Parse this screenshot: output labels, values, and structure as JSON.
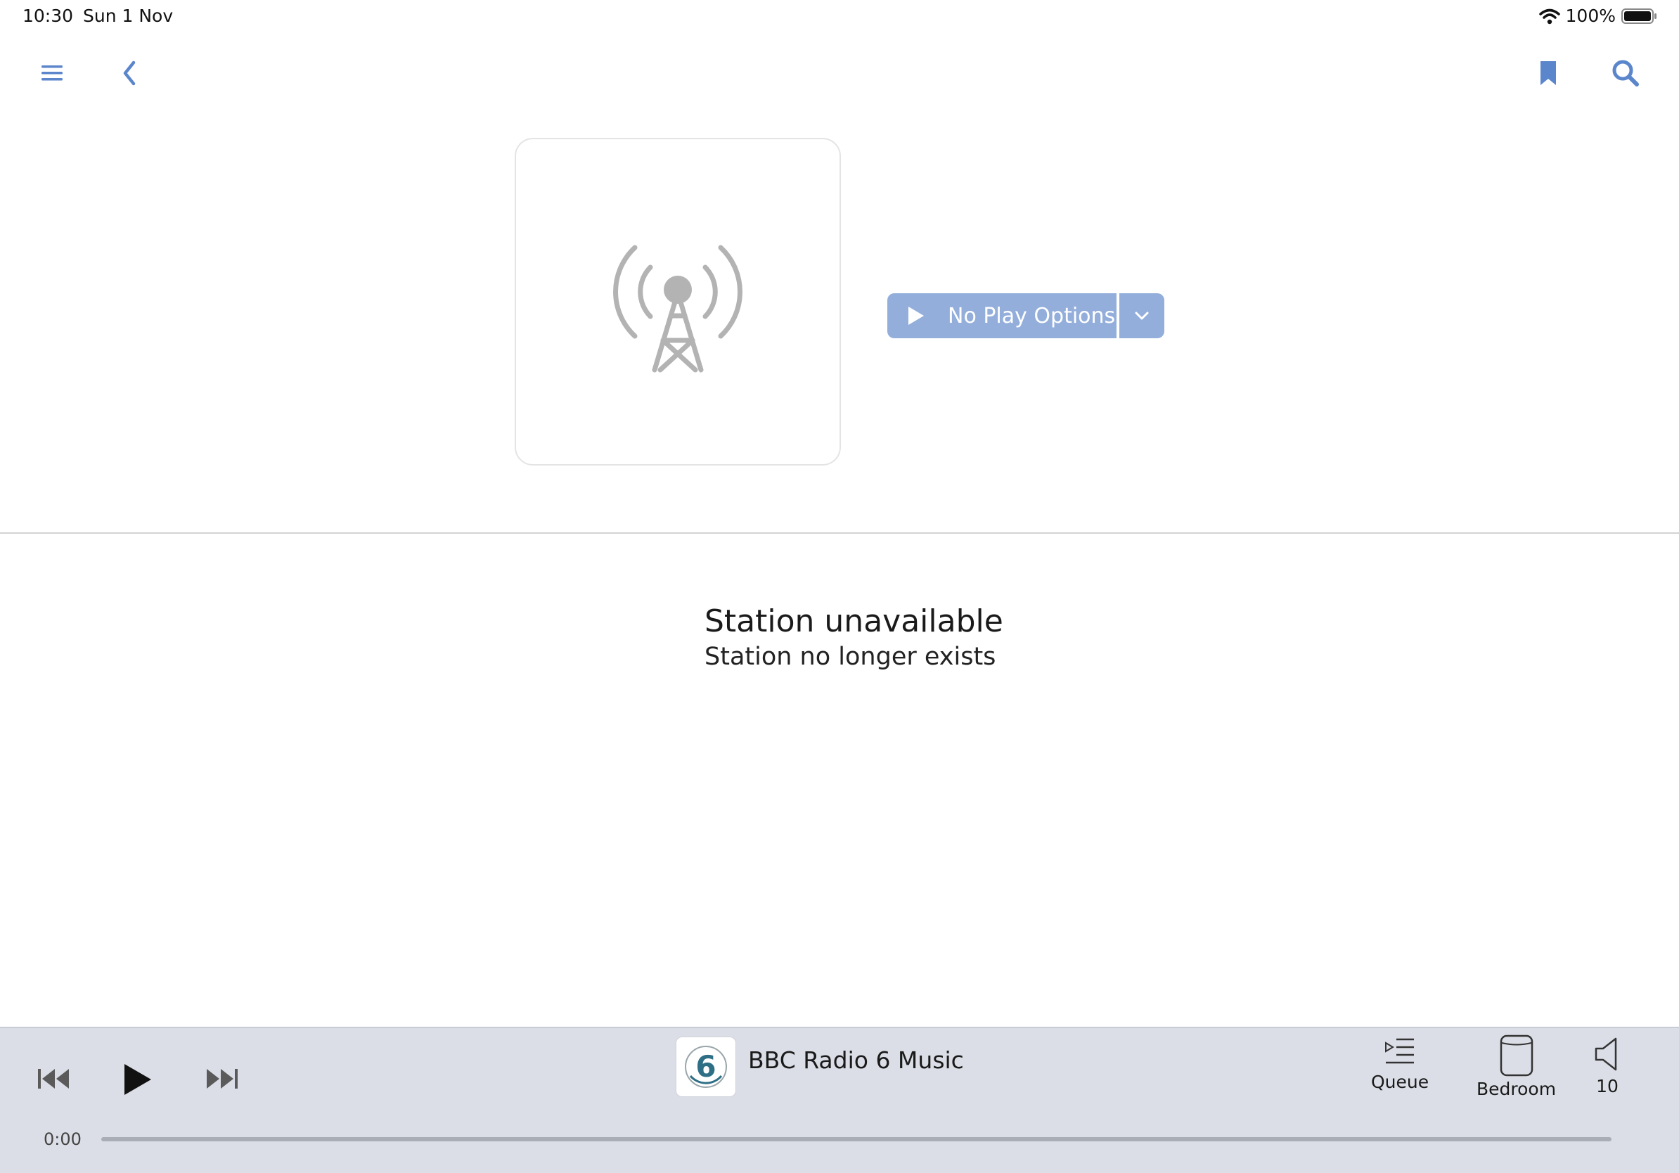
{
  "status_bar": {
    "time": "10:30",
    "date": "Sun 1 Nov",
    "battery": "100%"
  },
  "nav": {
    "menu_icon": "hamburger-icon",
    "back_icon": "chevron-left-icon",
    "bookmark_icon": "bookmark-icon",
    "search_icon": "search-icon"
  },
  "station": {
    "artwork_icon": "radio-tower-icon",
    "play_label": "No Play Options",
    "dropdown_icon": "chevron-down-icon"
  },
  "message": {
    "title": "Station unavailable",
    "subtitle": "Station no longer exists"
  },
  "player": {
    "station_name": "BBC Radio 6 Music",
    "elapsed": "0:00",
    "progress": 0,
    "queue_label": "Queue",
    "room_label": "Bedroom",
    "volume": "10"
  },
  "colors": {
    "accent": "#5b86cc",
    "button_bg": "#93aedb",
    "player_bg": "#dbdee6",
    "icon_gray": "#b3b3b3"
  }
}
